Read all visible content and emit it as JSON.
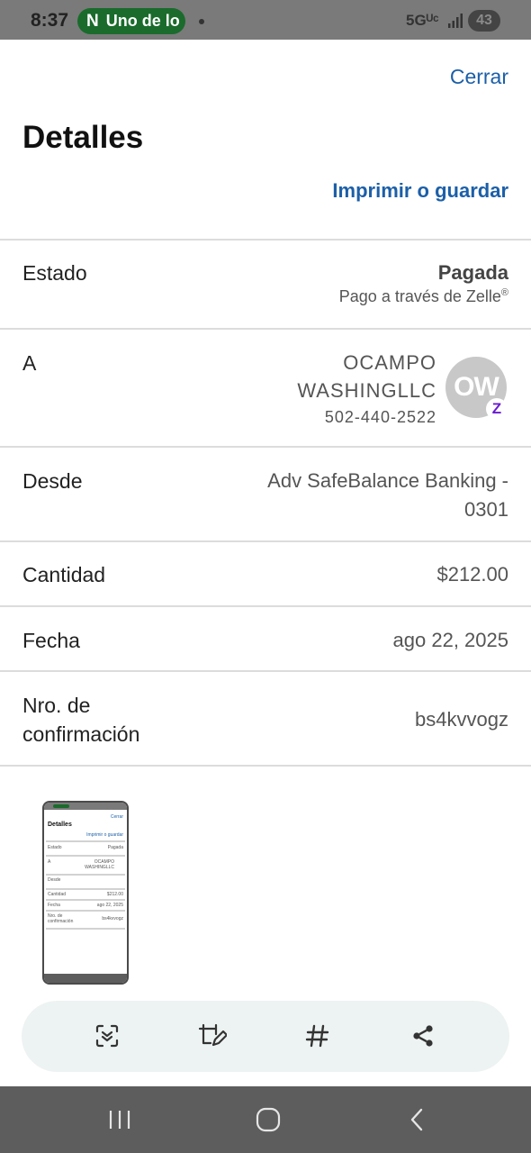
{
  "status_bar": {
    "time": "8:37",
    "pill_icon_letter": "N",
    "pill_text": "Uno de lo",
    "network": "5Gᵁᶜ",
    "battery": "43"
  },
  "header": {
    "close_label": "Cerrar",
    "title": "Detalles",
    "print_label": "Imprimir o guardar"
  },
  "details": {
    "status": {
      "label": "Estado",
      "value": "Pagada",
      "sub_text": "Pago a través de Zelle",
      "sub_mark": "®"
    },
    "to": {
      "label": "A",
      "name": "OCAMPO WASHINGLLC",
      "phone": "502-440-2522",
      "avatar_initials": "OW",
      "badge": "Z"
    },
    "from": {
      "label": "Desde",
      "value": "Adv SafeBalance Banking - 0301"
    },
    "amount": {
      "label": "Cantidad",
      "value": "$212.00"
    },
    "date": {
      "label": "Fecha",
      "value": "ago 22, 2025"
    },
    "confirmation": {
      "label": "Nro. de confirmación",
      "value": "bs4kvvogz"
    }
  },
  "toolbar": {
    "icons": [
      "scan-text-icon",
      "edit-crop-icon",
      "hashtag-icon",
      "share-icon"
    ]
  },
  "navbar": {
    "icons": [
      "recent-apps-icon",
      "home-icon",
      "back-icon"
    ]
  },
  "colors": {
    "link": "#1c5fa8",
    "status_bar": "#7a7a7a",
    "nav_bar": "#5d5d5d",
    "toolbar_bg": "#edf3f2",
    "zelle_purple": "#6b1cd1"
  }
}
